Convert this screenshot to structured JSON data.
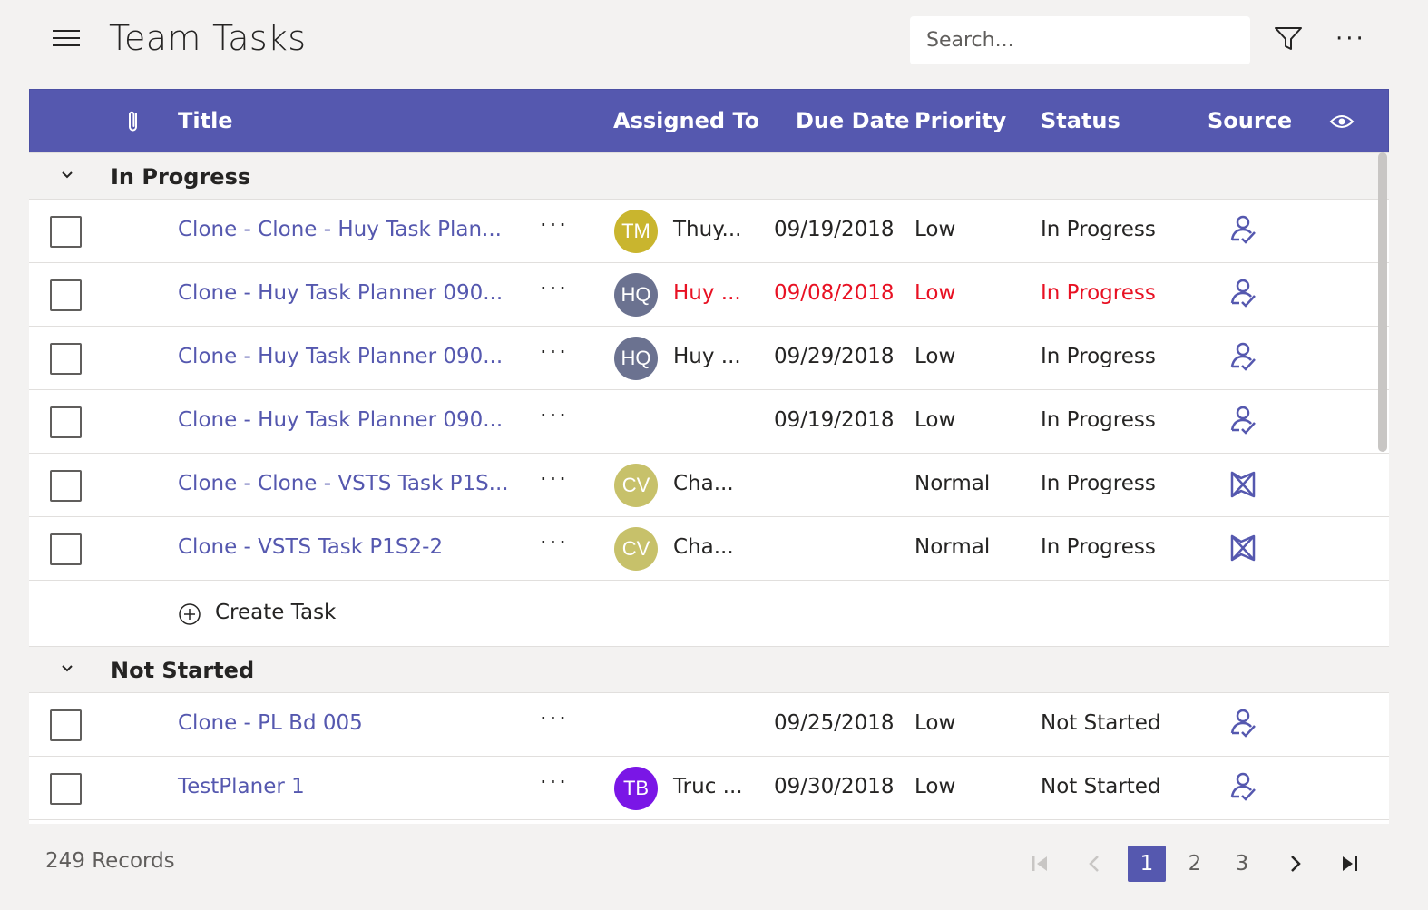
{
  "header": {
    "title": "Team Tasks",
    "search_placeholder": "Search...",
    "filter_icon": "filter-icon",
    "more_icon": "more-icon"
  },
  "colors": {
    "accent": "#5558af",
    "overdue": "#e81123",
    "background": "#f3f2f1"
  },
  "columns": {
    "attachment_icon": "paperclip-icon",
    "title": "Title",
    "assigned_to": "Assigned To",
    "due_date": "Due Date",
    "priority": "Priority",
    "status": "Status",
    "source": "Source",
    "view_icon": "eye-icon"
  },
  "groups": [
    {
      "name": "In Progress",
      "rows": [
        {
          "title": "Clone - Clone - Huy Task Plan...",
          "more": "···",
          "initials": "TM",
          "avatar_color": "#c9b52e",
          "assignee": "Thuy...",
          "due": "09/19/2018",
          "priority": "Low",
          "status": "In Progress",
          "source": "planner-icon",
          "overdue": false
        },
        {
          "title": "Clone - Huy Task Planner 090...",
          "more": "···",
          "initials": "HQ",
          "avatar_color": "#6b7290",
          "assignee": "Huy ...",
          "due": "09/08/2018",
          "priority": "Low",
          "status": "In Progress",
          "source": "planner-icon",
          "overdue": true
        },
        {
          "title": "Clone - Huy Task Planner 090...",
          "more": "···",
          "initials": "HQ",
          "avatar_color": "#6b7290",
          "assignee": "Huy ...",
          "due": "09/29/2018",
          "priority": "Low",
          "status": "In Progress",
          "source": "planner-icon",
          "overdue": false
        },
        {
          "title": "Clone - Huy Task Planner 090...",
          "more": "···",
          "initials": "",
          "avatar_color": "",
          "assignee": "",
          "due": "09/19/2018",
          "priority": "Low",
          "status": "In Progress",
          "source": "planner-icon",
          "overdue": false
        },
        {
          "title": "Clone - Clone - VSTS Task P1S...",
          "more": "···",
          "initials": "CV",
          "avatar_color": "#c7c16a",
          "assignee": "Cha...",
          "due": "",
          "priority": "Normal",
          "status": "In Progress",
          "source": "vsts-icon",
          "overdue": false
        },
        {
          "title": "Clone - VSTS Task P1S2-2",
          "more": "···",
          "initials": "CV",
          "avatar_color": "#c7c16a",
          "assignee": "Cha...",
          "due": "",
          "priority": "Normal",
          "status": "In Progress",
          "source": "vsts-icon",
          "overdue": false
        }
      ],
      "create_label": "Create Task"
    },
    {
      "name": "Not Started",
      "rows": [
        {
          "title": "Clone - PL Bd 005",
          "more": "···",
          "initials": "",
          "avatar_color": "",
          "assignee": "",
          "due": "09/25/2018",
          "priority": "Low",
          "status": "Not Started",
          "source": "planner-icon",
          "overdue": false
        },
        {
          "title": "TestPlaner 1",
          "more": "···",
          "initials": "TB",
          "avatar_color": "#7a16e6",
          "assignee": "Truc ...",
          "due": "09/30/2018",
          "priority": "Low",
          "status": "Not Started",
          "source": "planner-icon",
          "overdue": false
        }
      ]
    }
  ],
  "footer": {
    "records": "249 Records",
    "pages": [
      "1",
      "2",
      "3"
    ],
    "current_page": "1",
    "first_icon": "first-page-icon",
    "prev_icon": "prev-page-icon",
    "next_icon": "next-page-icon",
    "last_icon": "last-page-icon"
  }
}
